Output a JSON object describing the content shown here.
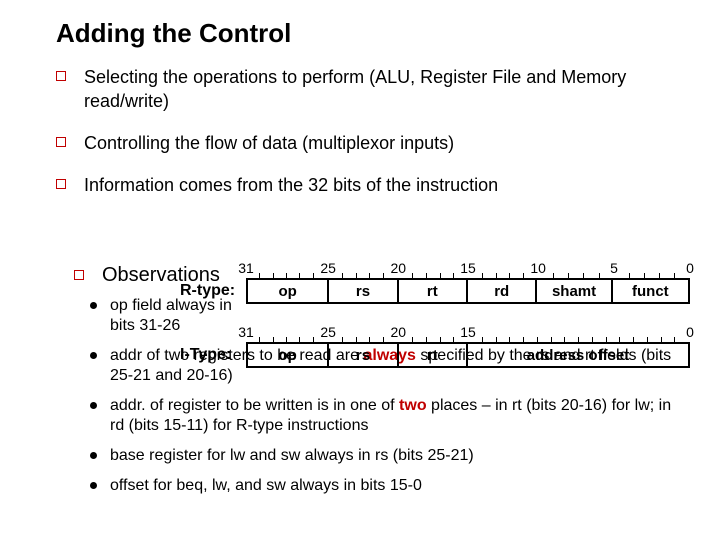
{
  "title": "Adding the Control",
  "bullets": {
    "b1": "Selecting the operations to perform (ALU, Register File and Memory read/write)",
    "b2": "Controlling the flow of data (multiplexor inputs)",
    "b3": "Information comes from the 32 bits of the instruction"
  },
  "obs_head": "Observations",
  "obs": {
    "o1a": "op field always in bits 31-26",
    "o2a": "addr of two registers to be read are ",
    "o2b": "always",
    "o2c": " specified by the rs and rt fields (bits 25-21 and 20-16)",
    "o3a": "addr. of register to be written is in one of ",
    "o3b": "two",
    "o3c": " places – in rt (bits 20-16) for lw; in rd (bits 15-11) for R-type instructions",
    "o4": "base register for lw and sw always in rs (bits 25-21)",
    "o5": "offset for beq, lw, and sw always in bits 15-0"
  },
  "rtype_label": "R-type:",
  "itype_label": "I-Type:",
  "rtype": {
    "f0": "op",
    "f1": "rs",
    "f2": "rt",
    "f3": "rd",
    "f4": "shamt",
    "f5": "funct"
  },
  "itype": {
    "f0": "op",
    "f1": "rs",
    "f2": "rt",
    "f3": "address offset"
  },
  "ticks_r": {
    "t31": "31",
    "t25": "25",
    "t20": "20",
    "t15": "15",
    "t10": "10",
    "t5": "5",
    "t0": "0"
  },
  "ticks_i": {
    "t31": "31",
    "t25": "25",
    "t20": "20",
    "t15": "15",
    "t0": "0"
  }
}
